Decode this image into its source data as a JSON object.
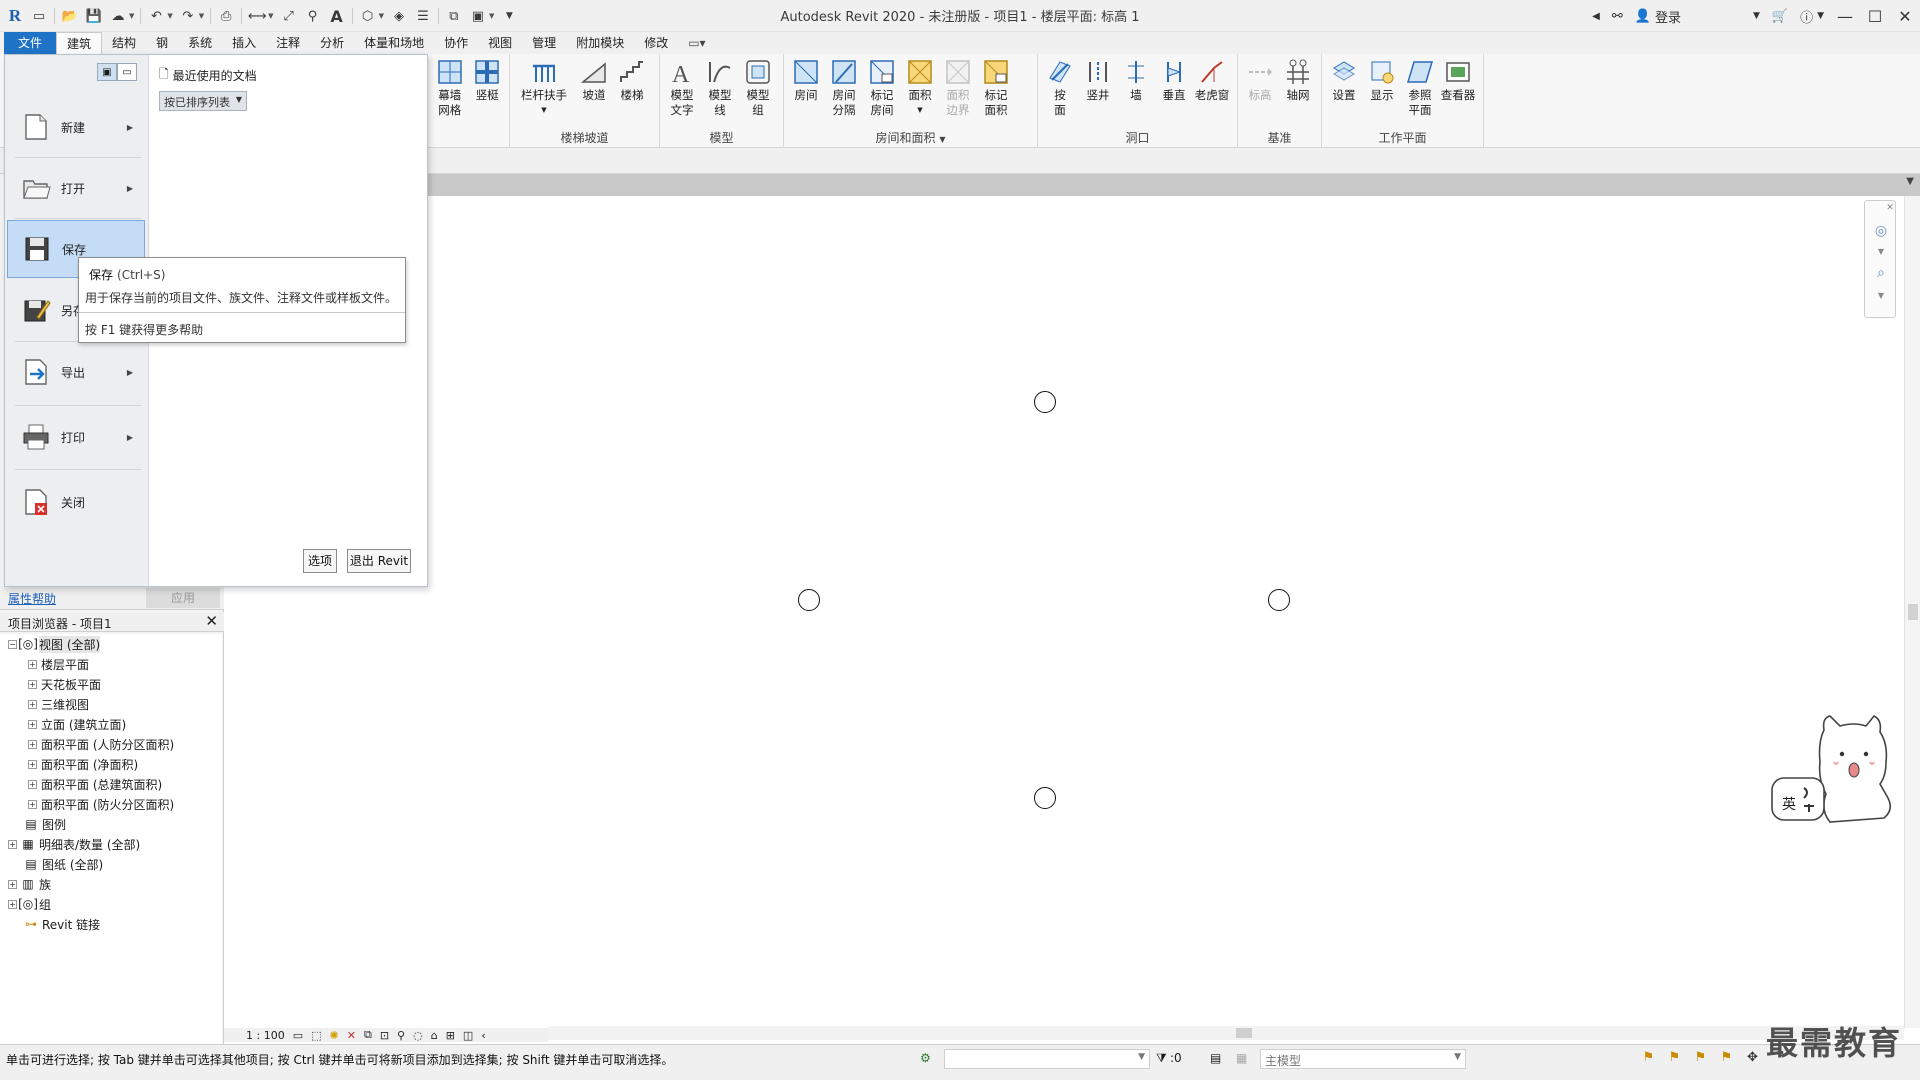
{
  "titlebar": {
    "title": "Autodesk Revit 2020 - 未注册版 - 项目1 - 楼层平面: 标高 1",
    "sign_in": "登录",
    "qat_icons": [
      "revit-logo",
      "open",
      "save",
      "sync",
      "undo",
      "redo",
      "print",
      "measure",
      "tag",
      "text",
      "default-3d",
      "sections",
      "close-hidden",
      "switch-windows"
    ]
  },
  "menu": {
    "tabs": [
      "文件",
      "建筑",
      "结构",
      "钢",
      "系统",
      "插入",
      "注释",
      "分析",
      "体量和场地",
      "协作",
      "视图",
      "管理",
      "附加模块",
      "修改"
    ],
    "active_tab": "建筑"
  },
  "ribbon": {
    "panels": [
      {
        "label": "",
        "buttons": [
          {
            "label": "幕墙\n网格"
          },
          {
            "label": "竖梃"
          }
        ]
      },
      {
        "label": "楼梯坡道",
        "buttons": [
          {
            "label": "栏杆扶手"
          },
          {
            "label": "坡道"
          },
          {
            "label": "楼梯"
          }
        ]
      },
      {
        "label": "模型",
        "buttons": [
          {
            "label": "模型\n文字"
          },
          {
            "label": "模型\n线"
          },
          {
            "label": "模型\n组"
          }
        ]
      },
      {
        "label": "房间和面积",
        "buttons": [
          {
            "label": "房间"
          },
          {
            "label": "房间\n分隔"
          },
          {
            "label": "标记\n房间"
          },
          {
            "label": "面积"
          },
          {
            "label": "面积\n边界",
            "disabled": true
          },
          {
            "label": "标记\n面积"
          }
        ]
      },
      {
        "label": "洞口",
        "buttons": [
          {
            "label": "按\n面"
          },
          {
            "label": "竖井"
          },
          {
            "label": "墙"
          },
          {
            "label": "垂直"
          },
          {
            "label": "老虎窗"
          }
        ]
      },
      {
        "label": "基准",
        "buttons": [
          {
            "label": "标高",
            "disabled": true
          },
          {
            "label": "轴网"
          }
        ]
      },
      {
        "label": "工作平面",
        "buttons": [
          {
            "label": "设置"
          },
          {
            "label": "显示"
          },
          {
            "label": "参照\n平面"
          },
          {
            "label": "查看器"
          }
        ]
      }
    ]
  },
  "app_menu": {
    "items": [
      {
        "label": "新建",
        "has_submenu": true
      },
      {
        "label": "打开",
        "has_submenu": true
      },
      {
        "label": "保存",
        "has_submenu": false,
        "hover": true
      },
      {
        "label": "另存为",
        "has_submenu": true
      },
      {
        "label": "导出",
        "has_submenu": true
      },
      {
        "label": "打印",
        "has_submenu": true
      },
      {
        "label": "关闭",
        "has_submenu": false
      }
    ],
    "recent_title": "最近使用的文档",
    "sort_option": "按已排序列表",
    "options_button": "选项",
    "exit_button": "退出 Revit"
  },
  "tooltip": {
    "title": "保存",
    "shortcut": "(Ctrl+S)",
    "description": "用于保存当前的项目文件、族文件、注释文件或样板文件。",
    "help": "按 F1 键获得更多帮助"
  },
  "properties": {
    "help_link": "属性帮助",
    "apply_button": "应用"
  },
  "project_browser": {
    "title": "项目浏览器 - 项目1",
    "nodes": [
      {
        "label": "视图 (全部)",
        "level": 0,
        "toggle": "−",
        "icon": "views-icon",
        "selected": true
      },
      {
        "label": "楼层平面",
        "level": 1,
        "toggle": "+"
      },
      {
        "label": "天花板平面",
        "level": 1,
        "toggle": "+"
      },
      {
        "label": "三维视图",
        "level": 1,
        "toggle": "+"
      },
      {
        "label": "立面 (建筑立面)",
        "level": 1,
        "toggle": "+"
      },
      {
        "label": "面积平面 (人防分区面积)",
        "level": 1,
        "toggle": "+"
      },
      {
        "label": "面积平面 (净面积)",
        "level": 1,
        "toggle": "+"
      },
      {
        "label": "面积平面 (总建筑面积)",
        "level": 1,
        "toggle": "+"
      },
      {
        "label": "面积平面 (防火分区面积)",
        "level": 1,
        "toggle": "+"
      },
      {
        "label": "图例",
        "level": 0,
        "toggle": "",
        "icon": "legend-icon"
      },
      {
        "label": "明细表/数量 (全部)",
        "level": 0,
        "toggle": "+",
        "icon": "schedule-icon"
      },
      {
        "label": "图纸 (全部)",
        "level": 0,
        "toggle": "",
        "icon": "sheet-icon"
      },
      {
        "label": "族",
        "level": 0,
        "toggle": "+",
        "icon": "family-icon"
      },
      {
        "label": "组",
        "level": 0,
        "toggle": "+",
        "icon": "group-icon"
      },
      {
        "label": "Revit 链接",
        "level": 0,
        "toggle": "",
        "icon": "link-icon"
      }
    ]
  },
  "view_control": {
    "scale": "1 : 100"
  },
  "status": {
    "hint": "单击可进行选择; 按 Tab 键并单击可选择其他项目; 按 Ctrl 键并单击可将新项目添加到选择集; 按 Shift 键并单击可取消选择。",
    "selection_count": ":0",
    "model": "主模型"
  },
  "sticker": {
    "text": "英"
  },
  "watermark": "最需教育",
  "colors": {
    "file_tab": "#1f73c6",
    "hover_item": "#c4dcf5",
    "help_link": "#1b5fb8"
  }
}
